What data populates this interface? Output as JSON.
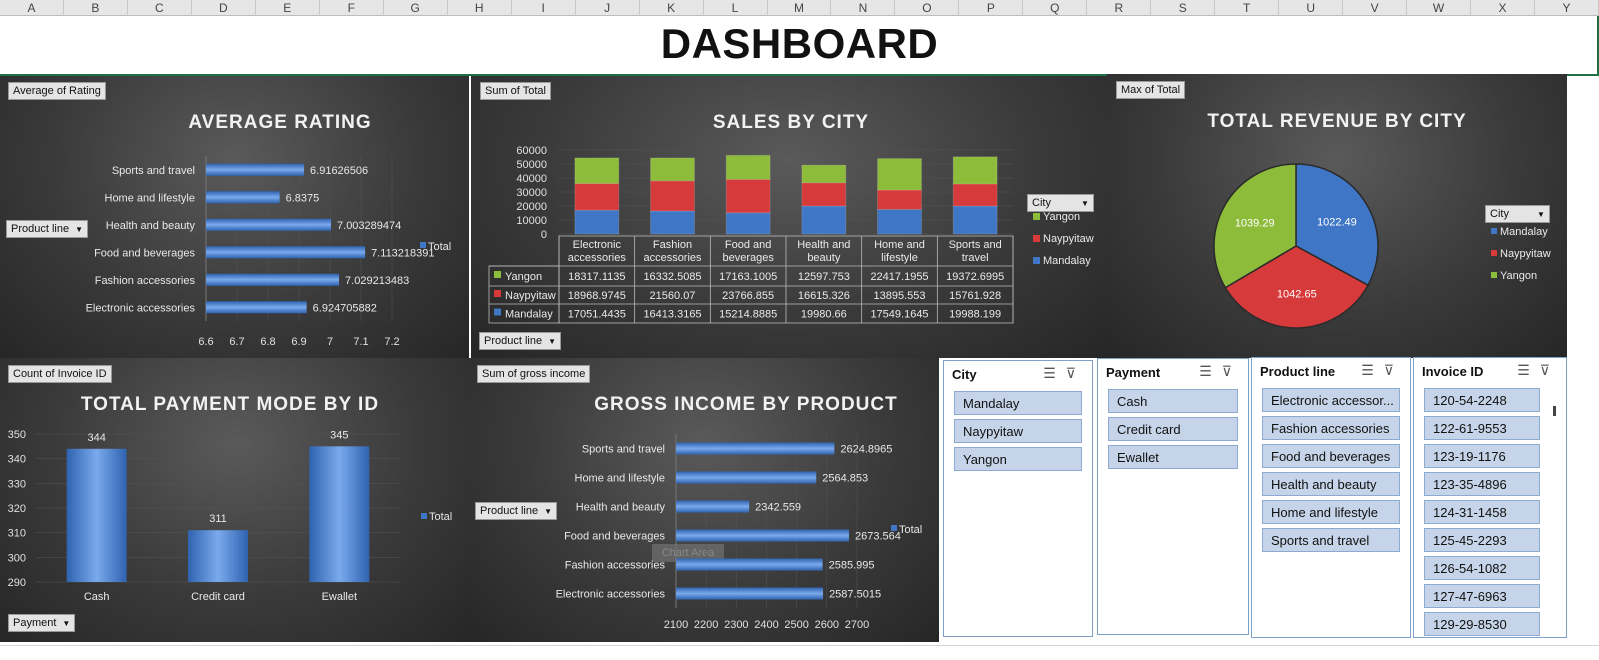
{
  "columns": [
    "A",
    "B",
    "C",
    "D",
    "E",
    "F",
    "G",
    "H",
    "I",
    "J",
    "K",
    "L",
    "M",
    "N",
    "O",
    "P",
    "Q",
    "R",
    "S",
    "T",
    "U",
    "V",
    "W",
    "X",
    "Y"
  ],
  "dashboard_title": "DASHBOARD",
  "panels": {
    "avg_rating": {
      "field_chip": "Average of Rating",
      "title": "AVERAGE RATING",
      "filter": "Product line",
      "legend": "Total"
    },
    "sales_city": {
      "field_chip": "Sum of Total",
      "title": "SALES BY CITY",
      "filter": "Product line",
      "legend_title": "City"
    },
    "revenue_city": {
      "field_chip": "Max of Total",
      "title": "TOTAL REVENUE BY CITY",
      "legend_title": "City"
    },
    "payment": {
      "field_chip": "Count of Invoice ID",
      "title": "TOTAL PAYMENT MODE BY ID",
      "filter": "Payment",
      "legend": "Total"
    },
    "gross": {
      "field_chip": "Sum of gross income",
      "title": "GROSS INCOME BY PRODUCT",
      "filter": "Product line",
      "legend": "Total",
      "tooltip": "Chart Area"
    }
  },
  "chart_data": [
    {
      "id": "avg_rating",
      "type": "bar",
      "orientation": "horizontal",
      "title": "AVERAGE RATING",
      "categories": [
        "Electronic accessories",
        "Fashion accessories",
        "Food and beverages",
        "Health and beauty",
        "Home and lifestyle",
        "Sports and travel"
      ],
      "labels": [
        "6.924705882",
        "7.029213483",
        "7.113218391",
        "7.003289474",
        "6.8375",
        "6.91626506"
      ],
      "values": [
        6.924705882,
        7.029213483,
        7.113218391,
        7.003289474,
        6.8375,
        6.91626506
      ],
      "xlim": [
        6.6,
        7.2
      ],
      "xticks": [
        "6.6",
        "6.7",
        "6.8",
        "6.9",
        "7",
        "7.1",
        "7.2"
      ],
      "series_name": "Total"
    },
    {
      "id": "sales_city",
      "type": "bar",
      "stacked": true,
      "title": "SALES BY CITY",
      "categories": [
        "Electronic accessories",
        "Fashion accessories",
        "Food and beverages",
        "Health and beauty",
        "Home and lifestyle",
        "Sports and travel"
      ],
      "category_lines": [
        [
          "Electronic",
          "accessories"
        ],
        [
          "Fashion",
          "accessories"
        ],
        [
          "Food and",
          "beverages"
        ],
        [
          "Health and",
          "beauty"
        ],
        [
          "Home and",
          "lifestyle"
        ],
        [
          "Sports and",
          "travel"
        ]
      ],
      "ylim": [
        0,
        60000
      ],
      "yticks": [
        "0",
        "10000",
        "20000",
        "30000",
        "40000",
        "50000",
        "60000"
      ],
      "series": [
        {
          "name": "Mandalay",
          "color": "#3f76c6",
          "labels": [
            "17051.4435",
            "16413.3165",
            "15214.8885",
            "19980.66",
            "17549.1645",
            "19988.199"
          ],
          "values": [
            17051.4435,
            16413.3165,
            15214.8885,
            19980.66,
            17549.1645,
            19988.199
          ]
        },
        {
          "name": "Naypyitaw",
          "color": "#d63a3a",
          "labels": [
            "18968.9745",
            "21560.07",
            "23766.855",
            "16615.326",
            "13895.553",
            "15761.928"
          ],
          "values": [
            18968.9745,
            21560.07,
            23766.855,
            16615.326,
            13895.553,
            15761.928
          ]
        },
        {
          "name": "Yangon",
          "color": "#8dbb3a",
          "labels": [
            "18317.1135",
            "16332.5085",
            "17163.1005",
            "12597.753",
            "22417.1955",
            "19372.6995"
          ],
          "values": [
            18317.1135,
            16332.5085,
            17163.1005,
            12597.753,
            22417.1955,
            19372.6995
          ]
        }
      ],
      "legend_order": [
        "Yangon",
        "Naypyitaw",
        "Mandalay"
      ]
    },
    {
      "id": "revenue_city",
      "type": "pie",
      "title": "TOTAL REVENUE BY CITY",
      "slices": [
        {
          "name": "Mandalay",
          "value": 1022.49,
          "label": "1022.49",
          "color": "#3f76c6"
        },
        {
          "name": "Naypyitaw",
          "value": 1042.65,
          "label": "1042.65",
          "color": "#d63a3a"
        },
        {
          "name": "Yangon",
          "value": 1039.29,
          "label": "1039.29",
          "color": "#8dbb3a"
        }
      ]
    },
    {
      "id": "payment",
      "type": "bar",
      "title": "TOTAL PAYMENT MODE BY ID",
      "categories": [
        "Cash",
        "Credit card",
        "Ewallet"
      ],
      "values": [
        344,
        311,
        345
      ],
      "labels": [
        "344",
        "311",
        "345"
      ],
      "ylim": [
        290,
        350
      ],
      "yticks": [
        "290",
        "300",
        "310",
        "320",
        "330",
        "340",
        "350"
      ],
      "series_name": "Total"
    },
    {
      "id": "gross",
      "type": "bar",
      "orientation": "horizontal",
      "title": "GROSS INCOME BY PRODUCT",
      "categories": [
        "Electronic accessories",
        "Fashion accessories",
        "Food and beverages",
        "Health and beauty",
        "Home and lifestyle",
        "Sports and travel"
      ],
      "values": [
        2587.5015,
        2585.995,
        2673.564,
        2342.559,
        2564.853,
        2624.8965
      ],
      "labels": [
        "2587.5015",
        "2585.995",
        "2673.564",
        "2342.559",
        "2564.853",
        "2624.8965"
      ],
      "xlim": [
        2100,
        2700
      ],
      "xticks": [
        "2100",
        "2200",
        "2300",
        "2400",
        "2500",
        "2600",
        "2700"
      ],
      "series_name": "Total"
    }
  ],
  "slicers": [
    {
      "header": "City",
      "items": [
        "Mandalay",
        "Naypyitaw",
        "Yangon"
      ]
    },
    {
      "header": "Payment",
      "items": [
        "Cash",
        "Credit card",
        "Ewallet"
      ]
    },
    {
      "header": "Product line",
      "items": [
        "Electronic accessor...",
        "Fashion accessories",
        "Food and beverages",
        "Health and beauty",
        "Home and lifestyle",
        "Sports and travel"
      ]
    },
    {
      "header": "Invoice ID",
      "items": [
        "120-54-2248",
        "122-61-9553",
        "123-19-1176",
        "123-35-4896",
        "124-31-1458",
        "125-45-2293",
        "126-54-1082",
        "127-47-6963",
        "129-29-8530"
      ]
    }
  ]
}
